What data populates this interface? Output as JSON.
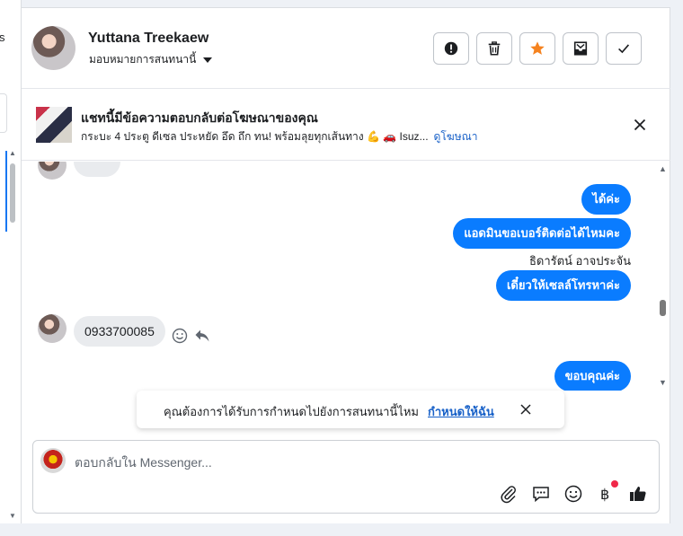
{
  "left_panel": {
    "fragment": "s"
  },
  "header": {
    "name": "Yuttana Treekaew",
    "assign_label": "มอบหมายการสนทนานี้",
    "toolbar": [
      "alert-icon",
      "trash-icon",
      "star-icon",
      "archive-icon",
      "check-icon"
    ],
    "star_color": "#f5821f"
  },
  "ad": {
    "title": "แชทนี้มีข้อความตอบกลับต่อโฆษณาของคุณ",
    "subtitle": "กระบะ 4 ประตู ดีเซล ประหยัด อึด ถึก ทน! พร้อมลุยทุกเส้นทาง 💪 🚗 Isuz...",
    "link": "ดูโฆษณา"
  },
  "messages": {
    "out1": "ได้ค่ะ",
    "out2": "แอดมินขอเบอร์ติดต่อได้ไหมคะ",
    "sender": "ธิดารัตน์ อาจประจัน",
    "out3": "เดี๋ยวให้เซลล์โทรหาค่ะ",
    "in1": "0933700085",
    "out4": "ขอบคุณค่ะ"
  },
  "toast": {
    "text": "คุณต้องการได้รับการกำหนดไปยังการสนทนานี้ไหม",
    "link": "กำหนดให้ฉัน"
  },
  "composer": {
    "placeholder": "ตอบกลับใน Messenger...",
    "value": "",
    "icons": [
      "paperclip-icon",
      "saved-reply-icon",
      "emoji-icon",
      "baht-icon",
      "thumbs-up-icon"
    ]
  },
  "colors": {
    "accent": "#0a7cff",
    "link": "#1861c8"
  }
}
